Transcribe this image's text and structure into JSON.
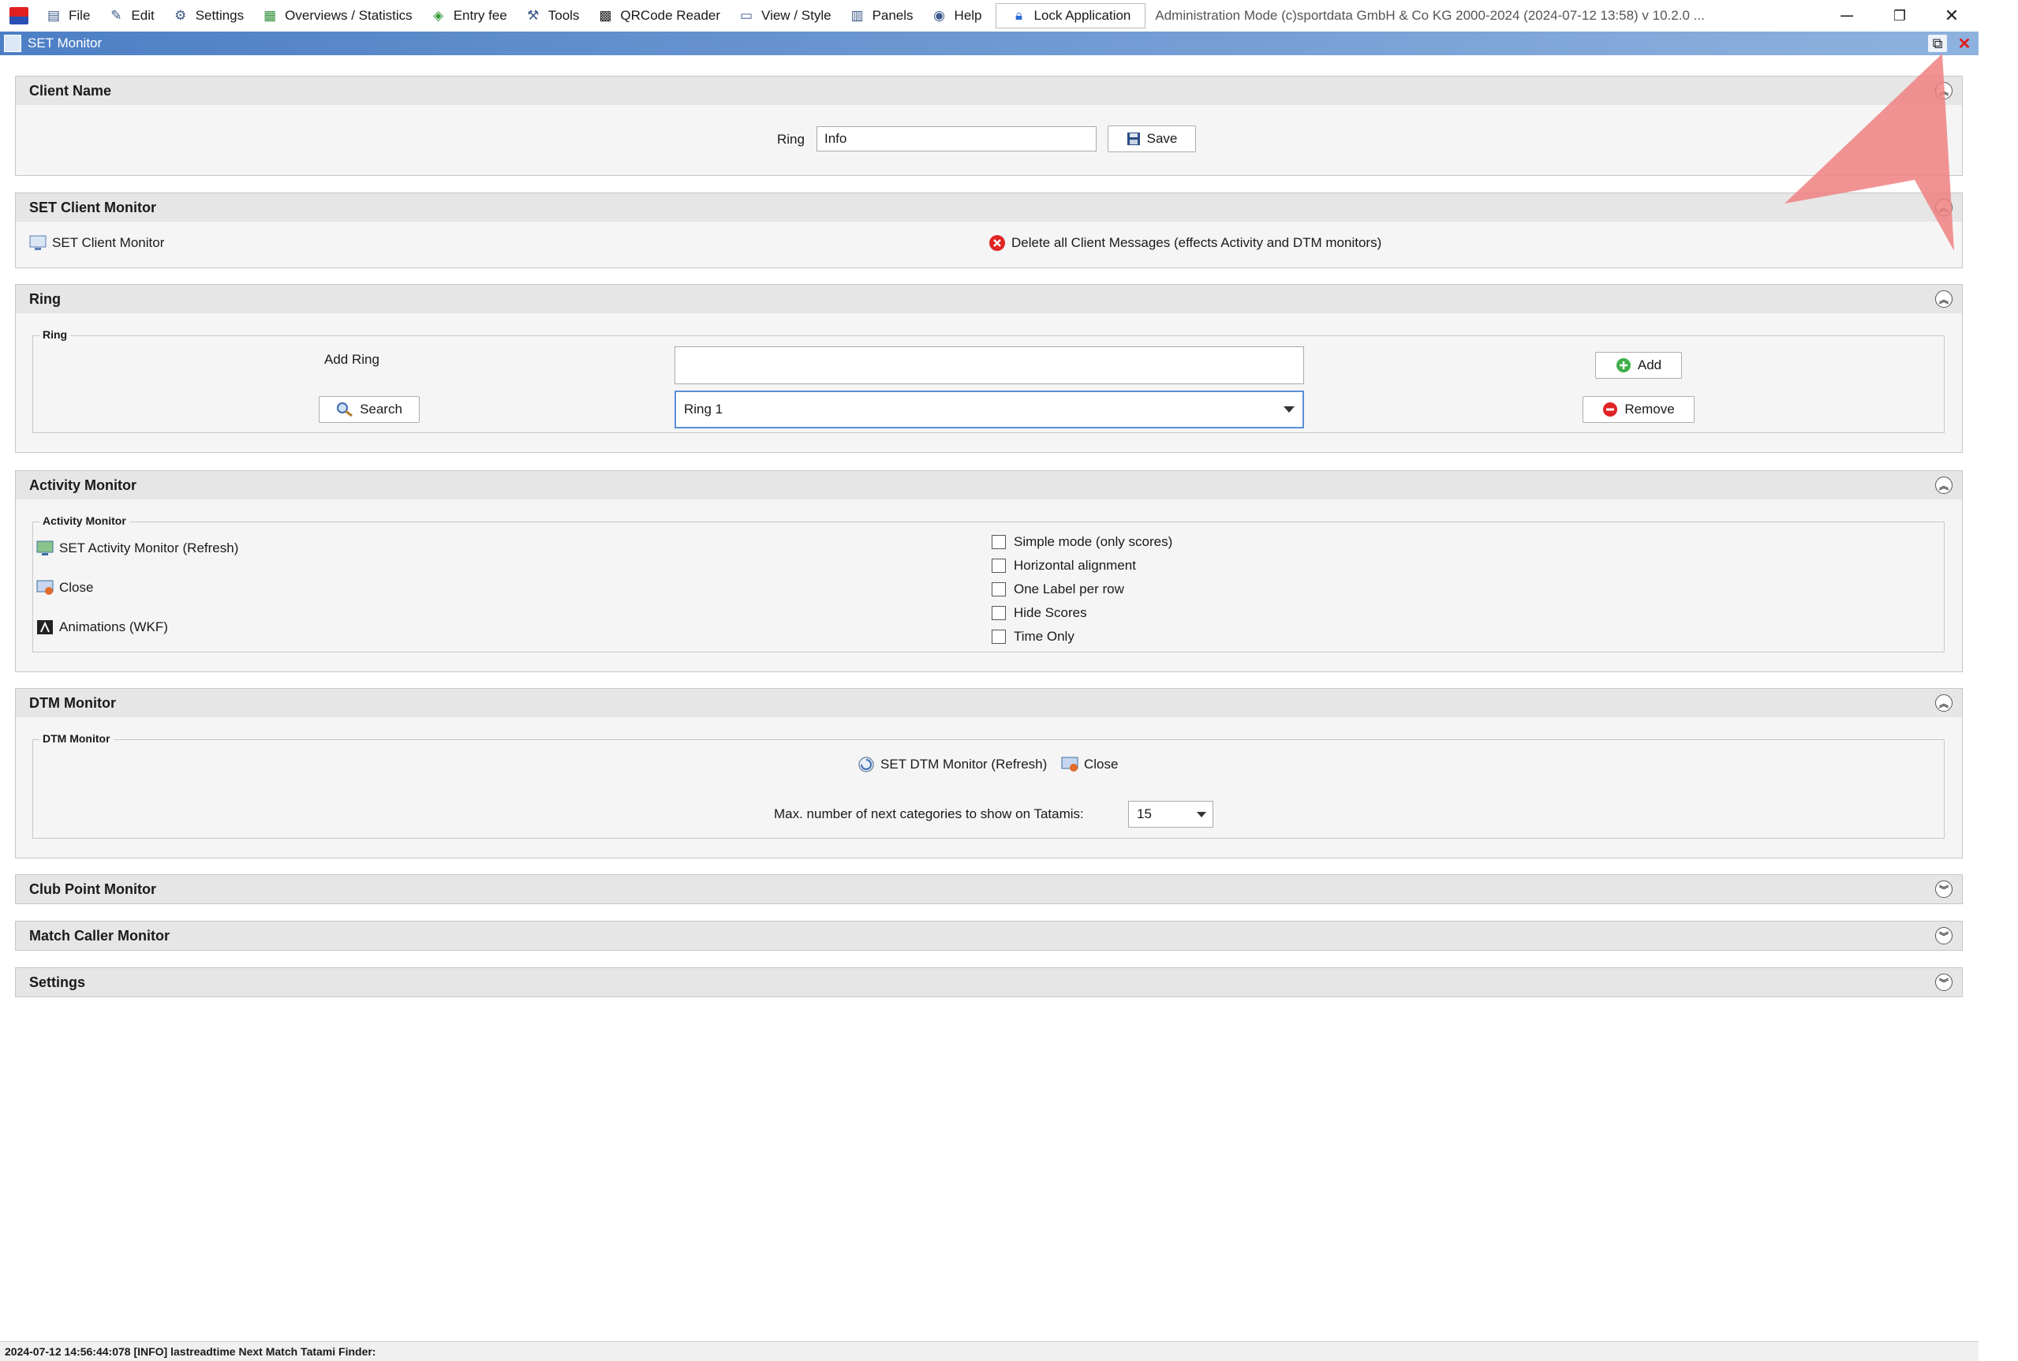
{
  "menubar": {
    "items": [
      {
        "label": "File",
        "icon": "file-icon"
      },
      {
        "label": "Edit",
        "icon": "edit-icon"
      },
      {
        "label": "Settings",
        "icon": "gear-icon"
      },
      {
        "label": "Overviews / Statistics",
        "icon": "statistics-icon"
      },
      {
        "label": "Entry fee",
        "icon": "money-icon"
      },
      {
        "label": "Tools",
        "icon": "wrench-icon"
      },
      {
        "label": "QRCode Reader",
        "icon": "qrcode-icon"
      },
      {
        "label": "View / Style",
        "icon": "view-icon"
      },
      {
        "label": "Panels",
        "icon": "panels-icon"
      },
      {
        "label": "Help",
        "icon": "help-icon"
      }
    ],
    "lock_label": "Lock Application",
    "title_info": "Administration Mode (c)sportdata GmbH & Co KG 2000-2024 (2024-07-12 13:58)  v 10.2.0 ..."
  },
  "window": {
    "title": "SET Monitor"
  },
  "client_name": {
    "header": "Client Name",
    "ring_label": "Ring",
    "ring_value": "Info",
    "save_label": "Save"
  },
  "set_client_monitor": {
    "header": "SET Client Monitor",
    "link_label": "SET Client Monitor",
    "delete_label": "Delete all Client Messages (effects Activity and DTM monitors)"
  },
  "ring": {
    "header": "Ring",
    "group_label": "Ring",
    "add_ring_label": "Add Ring",
    "add_ring_value": "",
    "search_label": "Search",
    "selected_ring": "Ring 1",
    "add_label": "Add",
    "remove_label": "Remove"
  },
  "activity_monitor": {
    "header": "Activity Monitor",
    "group_label": "Activity Monitor",
    "links": [
      "SET Activity Monitor (Refresh)",
      "Close",
      "Animations (WKF)"
    ],
    "options": [
      {
        "label": "Simple mode (only scores)",
        "checked": false
      },
      {
        "label": "Horizontal alignment",
        "checked": false
      },
      {
        "label": "One Label per row",
        "checked": false
      },
      {
        "label": "Hide Scores",
        "checked": false
      },
      {
        "label": "Time Only",
        "checked": false
      }
    ]
  },
  "dtm_monitor": {
    "header": "DTM Monitor",
    "group_label": "DTM Monitor",
    "refresh_label": "SET DTM Monitor (Refresh)",
    "close_label": "Close",
    "max_label": "Max. number of next categories to show on Tatamis:",
    "max_value": "15"
  },
  "collapsed_sections": [
    "Club Point Monitor",
    "Match Caller Monitor",
    "Settings"
  ],
  "statusbar": {
    "text": "2024-07-12 14:56:44:078 [INFO] lastreadtime Next Match Tatami Finder:"
  },
  "colors": {
    "accent": "#4d7fc5",
    "pointer": "#f08080",
    "close_red": "#e01b1b"
  }
}
